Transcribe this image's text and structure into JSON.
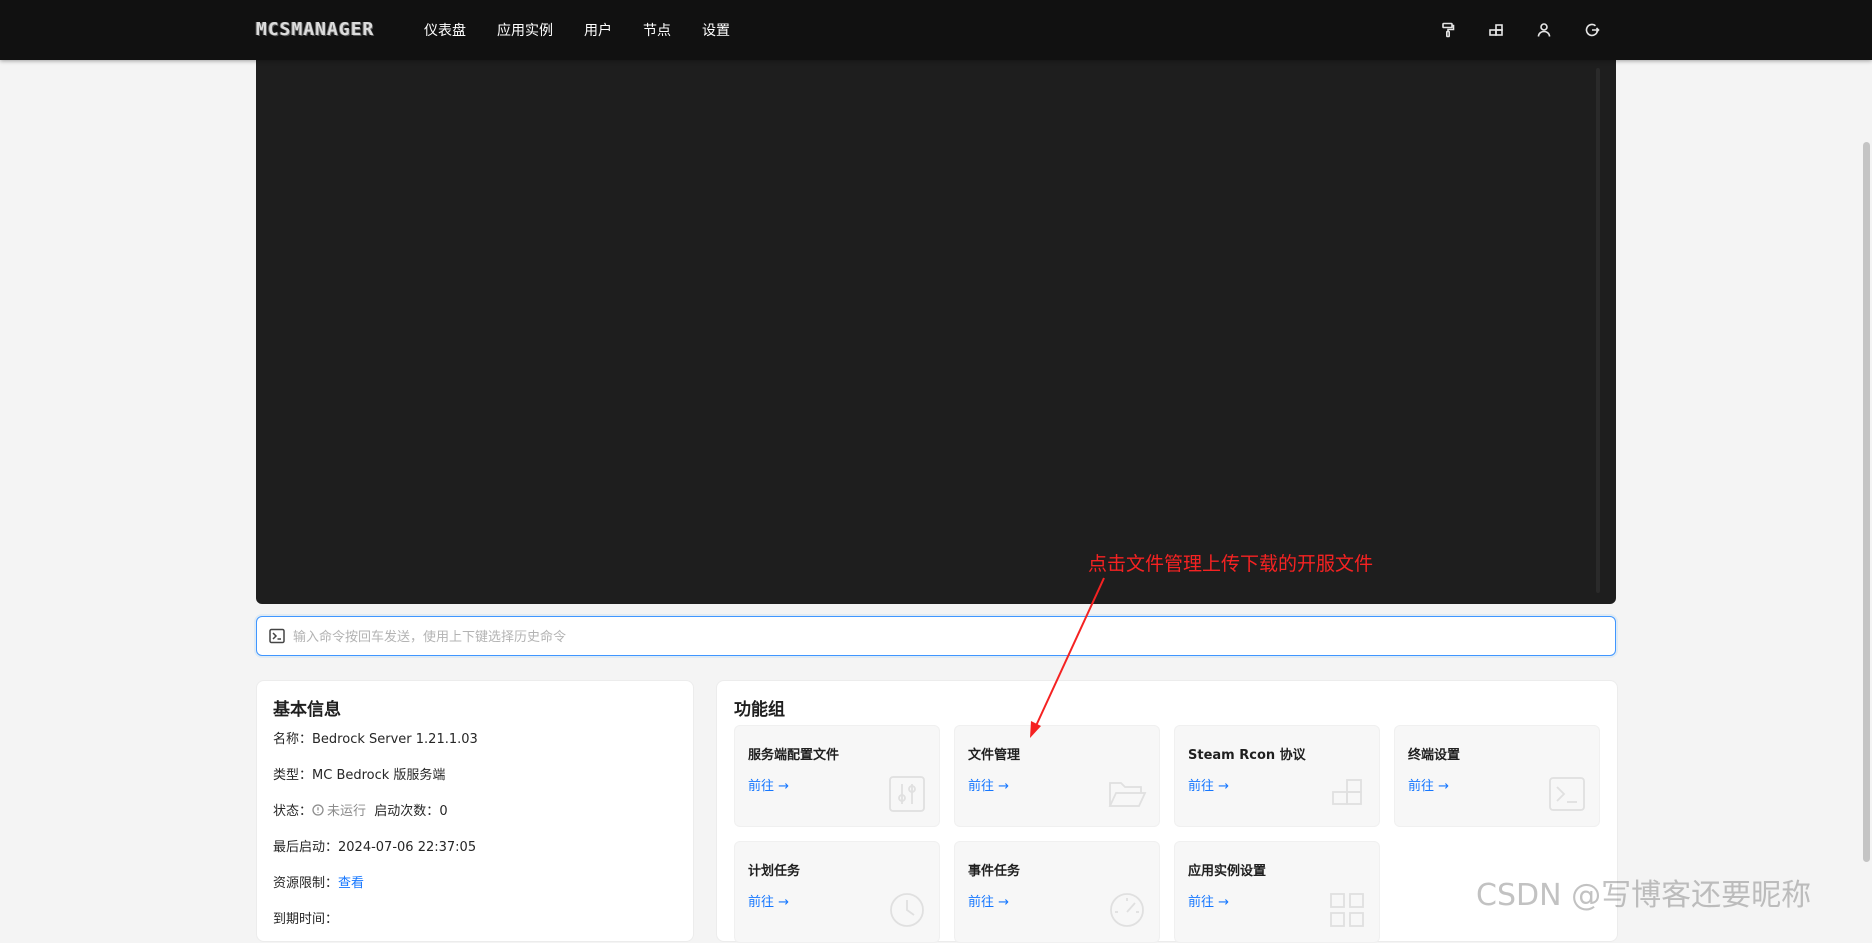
{
  "brand": {
    "logo_text": "MCSMANAGER"
  },
  "nav": {
    "items": [
      {
        "label": "仪表盘"
      },
      {
        "label": "应用实例"
      },
      {
        "label": "用户"
      },
      {
        "label": "节点"
      },
      {
        "label": "设置"
      }
    ]
  },
  "top_icons": [
    "paint-roller-icon",
    "cluster-icon",
    "user-icon",
    "logout-icon"
  ],
  "command": {
    "placeholder": "输入命令按回车发送，使用上下键选择历史命令",
    "value": ""
  },
  "basic_info": {
    "title": "基本信息",
    "name_label": "名称：",
    "name_value": "Bedrock Server 1.21.1.03",
    "type_label": "类型：",
    "type_value": "MC Bedrock 版服务端",
    "status_label": "状态：",
    "status_value": "未运行",
    "starts_label": "启动次数：",
    "starts_value": "0",
    "last_start_label": "最后启动：",
    "last_start_value": "2024-07-06 22:37:05",
    "resource_label": "资源限制：",
    "resource_link": "查看",
    "expire_label": "到期时间："
  },
  "functions": {
    "title": "功能组",
    "go_label": "前往",
    "tiles": [
      {
        "name": "服务端配置文件",
        "icon": "sliders-icon"
      },
      {
        "name": "文件管理",
        "icon": "folder-icon"
      },
      {
        "name": "Steam Rcon 协议",
        "icon": "blocks-icon"
      },
      {
        "name": "终端设置",
        "icon": "terminal-icon"
      },
      {
        "name": "计划任务",
        "icon": "clock-icon"
      },
      {
        "name": "事件任务",
        "icon": "gauge-icon"
      },
      {
        "name": "应用实例设置",
        "icon": "grid-icon"
      }
    ]
  },
  "annotation": {
    "text": "点击文件管理上传下载的开服文件",
    "color": "#f52222"
  },
  "watermark": {
    "text": "CSDN @写博客还要昵称"
  },
  "colors": {
    "accent": "#1677ff",
    "topbar": "#111111",
    "terminal": "#1e1e1e"
  }
}
